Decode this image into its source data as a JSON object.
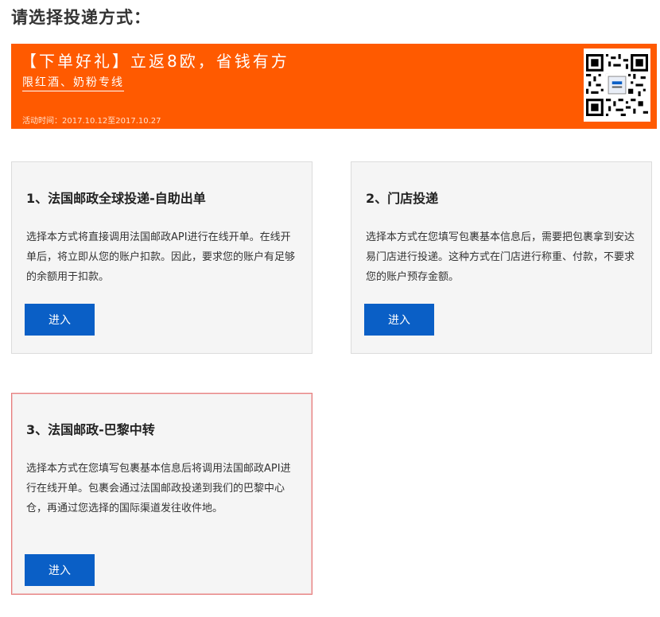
{
  "page_title": "请选择投递方式：",
  "banner": {
    "headline": "【下单好礼】立返8欧，省钱有方",
    "subline": "限红酒、奶粉专线",
    "period": "活动时间：2017.10.12至2017.10.27",
    "qr_icon": "qr-code-icon",
    "background_color": "#ff5a00"
  },
  "options": [
    {
      "title": "1、法国邮政全球投递-自助出单",
      "description": "选择本方式将直接调用法国邮政API进行在线开单。在线开单后，将立即从您的账户扣款。因此，要求您的账户有足够的余额用于扣款。",
      "button_label": "进入"
    },
    {
      "title": "2、门店投递",
      "description": "选择本方式在您填写包裹基本信息后，需要把包裹拿到安达易门店进行投递。这种方式在门店进行称重、付款，不要求您的账户预存金额。",
      "button_label": "进入"
    },
    {
      "title": "3、法国邮政-巴黎中转",
      "description": "选择本方式在您填写包裹基本信息后将调用法国邮政API进行在线开单。包裹会通过法国邮政投递到我们的巴黎中心仓，再通过您选择的国际渠道发往收件地。",
      "button_label": "进入"
    }
  ],
  "colors": {
    "button": "#0a5fc6",
    "card_background": "#f5f5f5",
    "selected_border": "#e57c7c"
  }
}
